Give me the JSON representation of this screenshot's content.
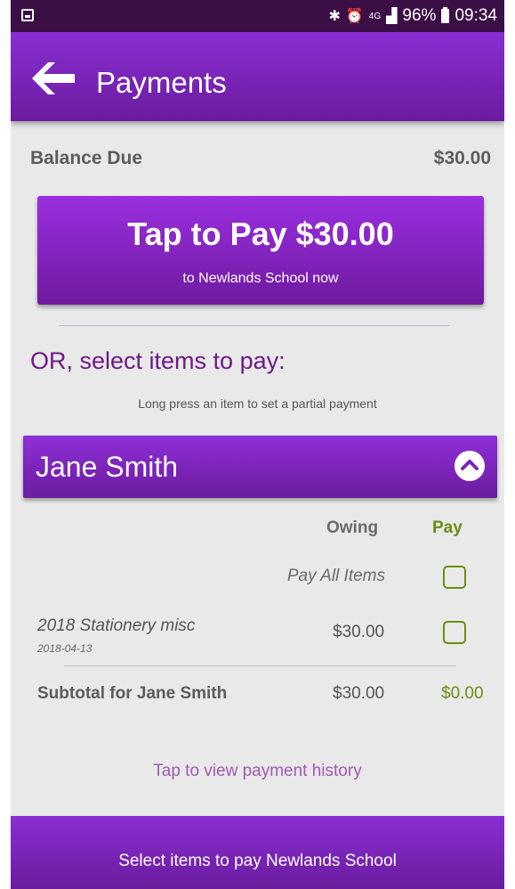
{
  "status_bar": {
    "icons": [
      "gallery-icon",
      "bluetooth-icon",
      "alarm-icon",
      "4g-icon",
      "signal-icon",
      "battery-icon"
    ],
    "network": "4G",
    "battery": "96%",
    "time": "09:34"
  },
  "app_bar": {
    "title": "Payments",
    "back_icon": "arrow-left-icon"
  },
  "balance": {
    "label": "Balance Due",
    "amount": "$30.00"
  },
  "pay_button": {
    "main": "Tap to Pay $30.00",
    "sub": "to Newlands School now"
  },
  "select": {
    "heading": "OR, select items to pay:",
    "hint": "Long press an item to set a partial payment"
  },
  "student": {
    "name": "Jane Smith",
    "collapse_icon": "chevron-up-icon",
    "columns": {
      "owing": "Owing",
      "pay": "Pay"
    },
    "pay_all_label": "Pay All Items",
    "items": [
      {
        "name": "2018 Stationery misc",
        "date": "2018-04-13",
        "owing": "$30.00",
        "checked": false
      }
    ],
    "subtotal": {
      "label": "Subtotal for Jane Smith",
      "owing": "$30.00",
      "pay": "$0.00"
    }
  },
  "history_link": "Tap to view payment history",
  "bottom_bar": "Select items to pay Newlands School",
  "colors": {
    "primary": "#7b26b8",
    "status_bar": "#3b0f45",
    "heading": "#6d1a86",
    "pay_green": "#6a8f12",
    "background": "#e9e9e9"
  }
}
